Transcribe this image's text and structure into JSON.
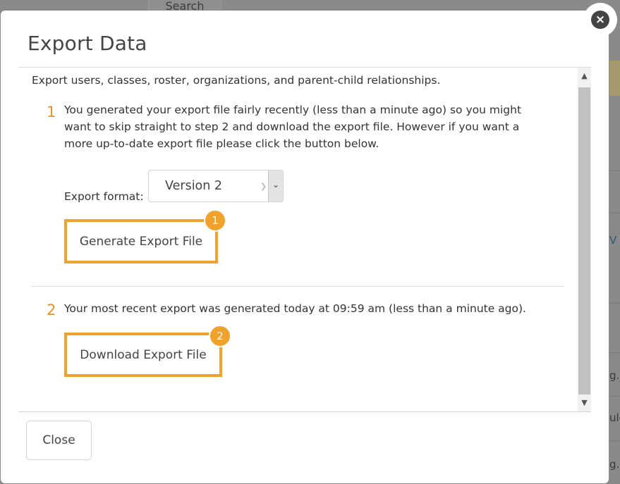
{
  "background": {
    "search_label": "Search",
    "fragments": [
      "V",
      "g.c",
      "ule",
      "g.c"
    ]
  },
  "modal": {
    "title": "Export Data",
    "intro": "Export users, classes, roster, organizations, and parent-child relationships.",
    "step1": {
      "number": "1",
      "text": "You generated your export file fairly recently (less than a minute ago) so you might want to skip straight to step 2 and download the export file. However if you want a more up-to-date export file please click the button below.",
      "format_label": "Export format:",
      "format_value": "Version 2",
      "button_label": "Generate Export File",
      "badge": "1"
    },
    "step2": {
      "number": "2",
      "text": "Your most recent export was generated today at 09:59 am (less than a minute ago).",
      "button_label": "Download Export File",
      "badge": "2"
    },
    "close_label": "Close",
    "x_close_glyph": "×"
  },
  "colors": {
    "accent": "#f0a22c",
    "step_number": "#e5922a",
    "x_button": "#444444"
  },
  "icons": {
    "close": "close-icon",
    "select": "chevron-down-icon",
    "scroll_up": "chevron-up-icon",
    "scroll_down": "chevron-down-icon"
  }
}
